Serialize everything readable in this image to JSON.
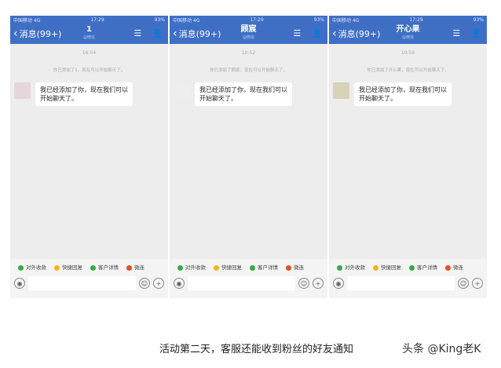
{
  "phones": [
    {
      "carrier": "中国移动 4G",
      "clock": "17:29",
      "battery": "93%",
      "back": "消息(99+)",
      "title": "1",
      "subtitle": "@微信",
      "time": "16:04",
      "system": "你已添加了1，现在可以开始聊天了。",
      "message": "我已经添加了你，现在我们可以开始聊天了。",
      "avatar": "#e6d6dc"
    },
    {
      "carrier": "中国移动 4G",
      "clock": "17:29",
      "battery": "93%",
      "back": "消息(99+)",
      "title": "顾宸",
      "subtitle": "@微信",
      "time": "10:52",
      "system": "你已添加了顾宸，现在可以开始聊天了。",
      "message": "我已经添加了你，现在我们可以开始聊天了。",
      "avatar": "#eeeeee"
    },
    {
      "carrier": "中国移动 4G",
      "clock": "17:29",
      "battery": "93%",
      "back": "消息(99+)",
      "title": "开心果",
      "subtitle": "@微信",
      "time": "10:59",
      "system": "你已添加了开心果，现在可以开始聊天了。",
      "message": "我已经添加了你，现在我们可以开始聊天了。",
      "avatar": "#d8d2b8"
    }
  ],
  "quick_actions": [
    {
      "label": "对外收款",
      "color": "#3aa84a"
    },
    {
      "label": "快捷回复",
      "color": "#f2b51c"
    },
    {
      "label": "客户详情",
      "color": "#3aa84a"
    },
    {
      "label": "微连",
      "color": "#e2531f"
    }
  ],
  "caption": "活动第二天，客服还能收到粉丝的好友通知",
  "watermark": "头条 @King老K"
}
